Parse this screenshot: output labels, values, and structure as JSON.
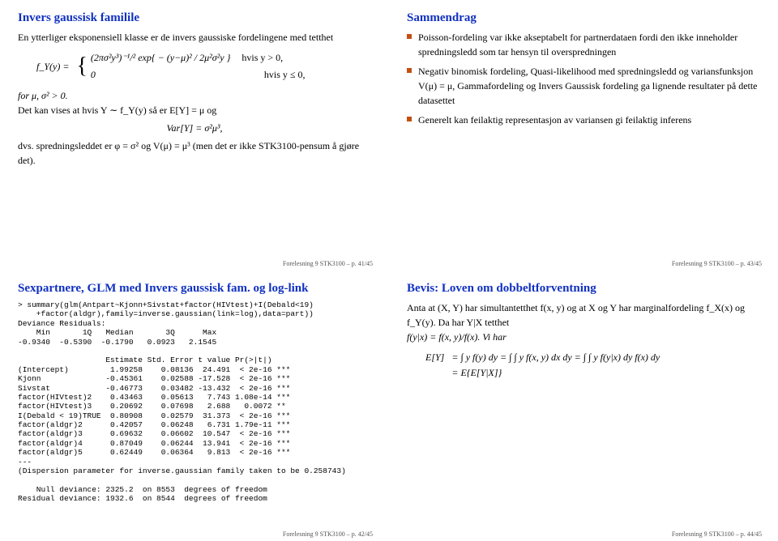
{
  "s1": {
    "title": "Invers gaussisk familile",
    "p1": "En ytterliger eksponensiell klasse er de invers gaussiske fordelingene med tetthet",
    "eq1_left": "f_Y(y) =",
    "eq1_case1a": "(2πσ²y³)⁻¹/² exp{ − (y−μ)² / 2μ²σ²y }",
    "eq1_case1b": "hvis y > 0,",
    "eq1_case2a": "0",
    "eq1_case2b": "hvis y ≤ 0,",
    "p2": "for μ, σ² > 0.",
    "p3": "Det kan vises at hvis Y ∼ f_Y(y) så er E[Y] = μ og",
    "eq2": "Var[Y] = σ²μ³,",
    "p4": "dvs. spredningsleddet er φ = σ² og V(μ) = μ³ (men det er ikke STK3100-pensum å gjøre det).",
    "footer": "Forelesning 9 STK3100 – p. 41/45"
  },
  "s2": {
    "title": "Sammendrag",
    "b1": "Poisson-fordeling var ikke akseptabelt for partnerdataen fordi den ikke inneholder spredningsledd som tar hensyn til overspredningen",
    "b2": "Negativ binomisk fordeling, Quasi-likelihood med spredningsledd og variansfunksjon V(μ) = μ, Gammafordeling og Invers Gaussisk fordeling ga lignende resultater på dette datasettet",
    "b3": "Generelt kan feilaktig representasjon av variansen gi feilaktig inferens",
    "footer": "Forelesning 9 STK3100 – p. 43/45"
  },
  "s3": {
    "title": "Sexpartnere, GLM med Invers gaussisk fam. og log-link",
    "code": "> summary(glm(Antpart~Kjonn+Sivstat+factor(HIVtest)+I(Debald<19)\n    +factor(aldgr),family=inverse.gaussian(link=log),data=part))\nDeviance Residuals:\n    Min       1Q   Median       3Q      Max\n-0.9340  -0.5390  -0.1790   0.0923   2.1545\n\n                   Estimate Std. Error t value Pr(>|t|)\n(Intercept)         1.99258    0.08136  24.491  < 2e-16 ***\nKjonn              -0.45361    0.02588 -17.528  < 2e-16 ***\nSivstat            -0.46773    0.03482 -13.432  < 2e-16 ***\nfactor(HIVtest)2    0.43463    0.05613   7.743 1.08e-14 ***\nfactor(HIVtest)3    0.20692    0.07698   2.688   0.0072 **\nI(Debald < 19)TRUE  0.80908    0.02579  31.373  < 2e-16 ***\nfactor(aldgr)2      0.42057    0.06248   6.731 1.79e-11 ***\nfactor(aldgr)3      0.69632    0.06602  10.547  < 2e-16 ***\nfactor(aldgr)4      0.87049    0.06244  13.941  < 2e-16 ***\nfactor(aldgr)5      0.62449    0.06364   9.813  < 2e-16 ***\n---\n(Dispersion parameter for inverse.gaussian family taken to be 0.258743)\n\n    Null deviance: 2325.2  on 8553  degrees of freedom\nResidual deviance: 1932.6  on 8544  degrees of freedom",
    "footer": "Forelesning 9 STK3100 – p. 42/45"
  },
  "s4": {
    "title": "Bevis: Loven om dobbeltforventning",
    "p1a": "Anta at (X, Y) har simultantetthet f(x, y) og at X og Y har marginalfordeling f_X(x) og f_Y(y). Da har Y|X tetthet",
    "p1b": "f(y|x) = f(x, y)/f(x). Vi har",
    "eq1_l": "E[Y]",
    "eq1_r1": "= ∫ y f(y) dy = ∫ ∫ y f(x, y) dx dy = ∫ ∫ y f(y|x) dy f(x) dy",
    "eq1_r2": "= E{E[Y|X]}",
    "footer": "Forelesning 9 STK3100 – p. 44/45"
  }
}
